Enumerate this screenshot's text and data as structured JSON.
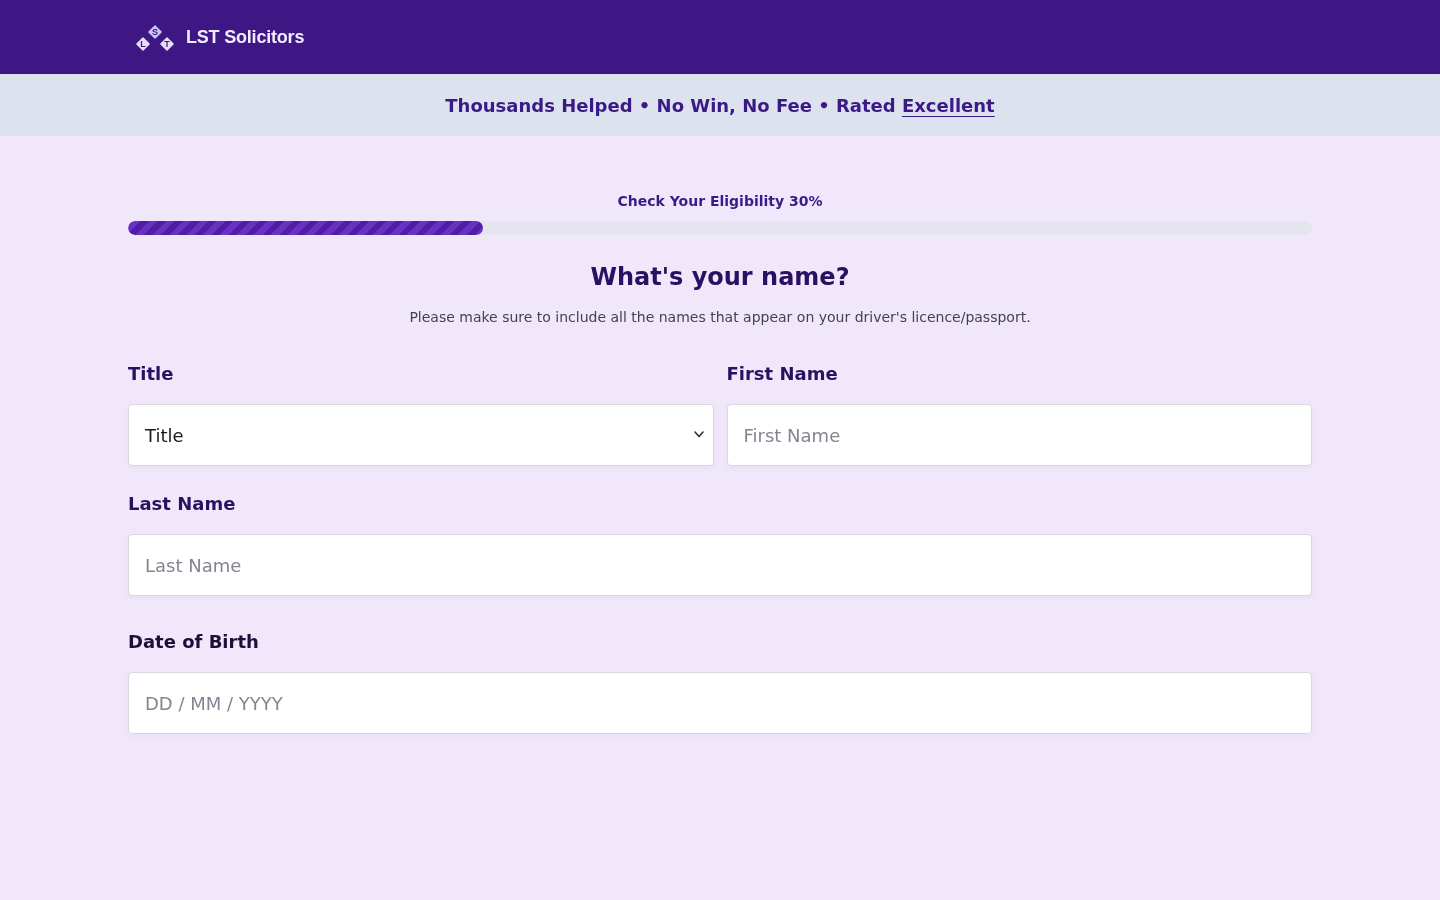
{
  "header": {
    "logo": {
      "letters": [
        "S",
        "L",
        "T"
      ],
      "name": "LST Solicitors"
    }
  },
  "trust_banner": {
    "text": "Thousands Helped • No Win, No Fee • Rated",
    "link": "Excellent"
  },
  "progress": {
    "label": "Check Your Eligibility 30%",
    "level": 0.3
  },
  "question": {
    "title": "What's your name?",
    "subtitle": "Please make sure to include all the names that appear on your driver's licence/passport."
  },
  "form_rows": [
    [
      {
        "kind": "select",
        "label": "Title",
        "value": "Title"
      },
      {
        "kind": "text",
        "label": "First Name",
        "placeholder": "First Name"
      }
    ],
    [
      {
        "kind": "text",
        "label": "Last Name",
        "placeholder": "Last Name"
      }
    ],
    [
      {
        "kind": "text",
        "label": "Date of Birth",
        "placeholder": "DD / MM / YYYY"
      }
    ]
  ]
}
